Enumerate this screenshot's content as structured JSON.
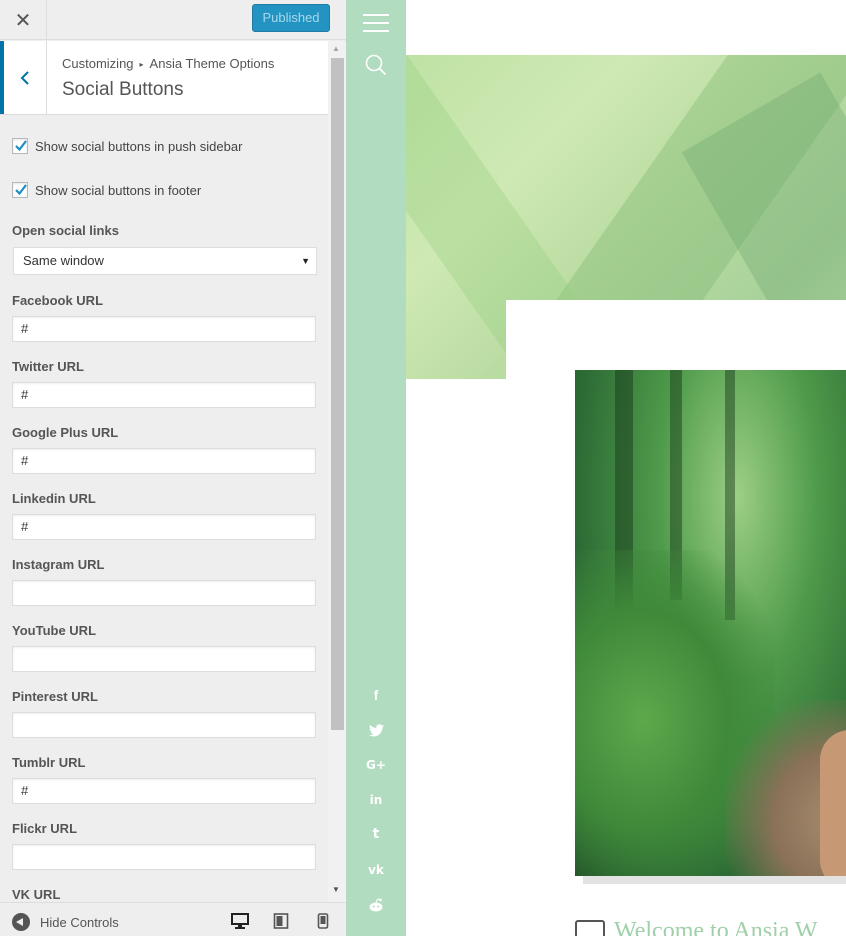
{
  "topbar": {
    "close_symbol": "✕",
    "publish_label": "Published"
  },
  "section": {
    "breadcrumb_root": "Customizing",
    "breadcrumb_sep": "▸",
    "breadcrumb_parent": "Ansia Theme Options",
    "title": "Social Buttons"
  },
  "controls": {
    "checkbox_sidebar_label": "Show social buttons in push sidebar",
    "checkbox_sidebar_checked": true,
    "checkbox_footer_label": "Show social buttons in footer",
    "checkbox_footer_checked": true,
    "open_links_label": "Open social links",
    "open_links_value": "Same window",
    "select_arrow": "▼",
    "url_fields": [
      {
        "label": "Facebook URL",
        "value": "#"
      },
      {
        "label": "Twitter URL",
        "value": "#"
      },
      {
        "label": "Google Plus URL",
        "value": "#"
      },
      {
        "label": "Linkedin URL",
        "value": "#"
      },
      {
        "label": "Instagram URL",
        "value": ""
      },
      {
        "label": "YouTube URL",
        "value": ""
      },
      {
        "label": "Pinterest URL",
        "value": ""
      },
      {
        "label": "Tumblr URL",
        "value": "#"
      },
      {
        "label": "Flickr URL",
        "value": ""
      },
      {
        "label": "VK URL",
        "value": ""
      }
    ]
  },
  "scrollbar": {
    "up_arrow": "▲",
    "down_arrow": "▼"
  },
  "footer": {
    "hide_controls_label": "Hide Controls",
    "devices": [
      "desktop-icon",
      "tablet-icon",
      "mobile-icon"
    ]
  },
  "preview": {
    "strip_color": "#b2dcbf",
    "social_glyphs": {
      "facebook": "f",
      "twitter": "🐦",
      "googleplus": "G+",
      "linkedin": "in",
      "tumblr": "t",
      "vk": "vk",
      "reddit": "●"
    },
    "post_title": "Welcome to Ansia W"
  },
  "colors": {
    "accent": "#0073aa",
    "publish_button": "#0085ba",
    "post_title": "#9fd0a9"
  }
}
